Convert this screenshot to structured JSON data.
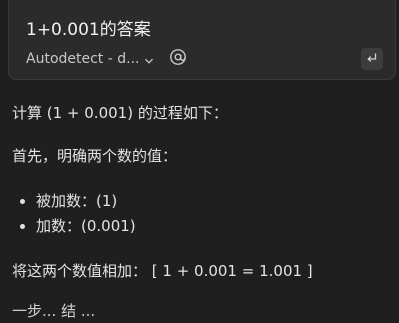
{
  "query": {
    "text": "1+0.001的答案",
    "model_label": "Autodetect - d...",
    "chevron_icon": "chevron-down-icon",
    "at_icon": "at-sign-icon",
    "submit_icon": "enter-key-icon"
  },
  "answer": {
    "intro": "计算 (1 + 0.001) 的过程如下：",
    "step1": "首先，明确两个数的值：",
    "bullets": [
      "被加数：(1)",
      "加数：(0.001)"
    ],
    "step2": "将这两个数值相加： [ 1 + 0.001 = 1.001 ]",
    "partial": "一步... 结 ..."
  },
  "colors": {
    "background": "#1f1f1f",
    "panel": "#2b2b2b",
    "text": "#e6e6e6"
  }
}
